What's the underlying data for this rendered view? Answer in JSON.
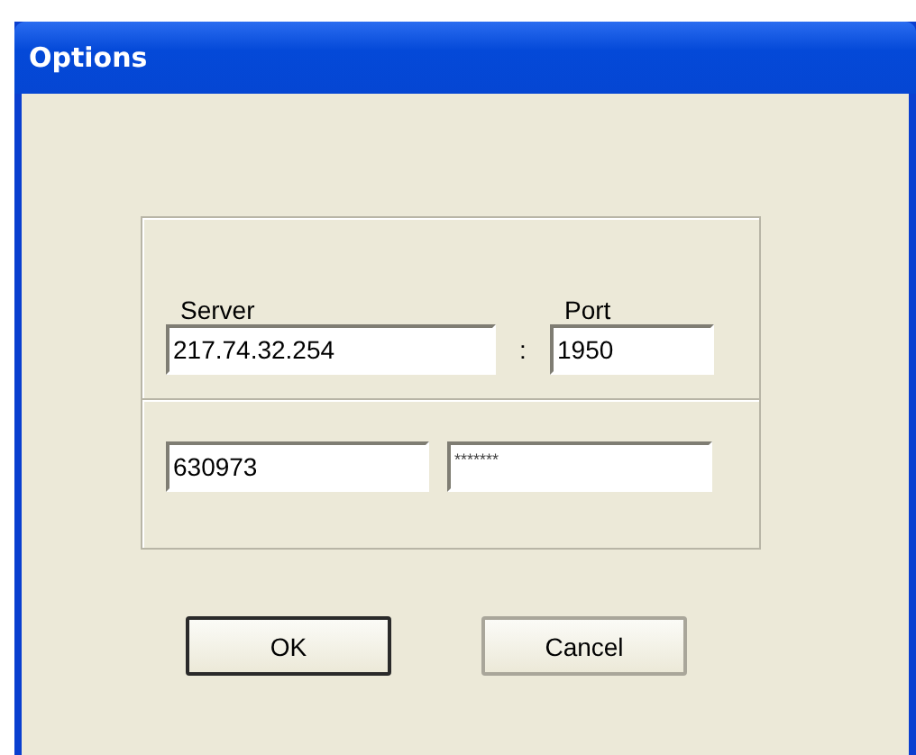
{
  "window": {
    "title": "Options"
  },
  "server": {
    "label": "Server",
    "value": "217.74.32.254"
  },
  "separator": ":",
  "port": {
    "label": "Port",
    "value": "1950"
  },
  "login": {
    "value": "630973"
  },
  "password": {
    "value": "*******"
  },
  "buttons": [
    {
      "label": "OK",
      "default": true
    },
    {
      "label": "Cancel",
      "default": false
    }
  ]
}
